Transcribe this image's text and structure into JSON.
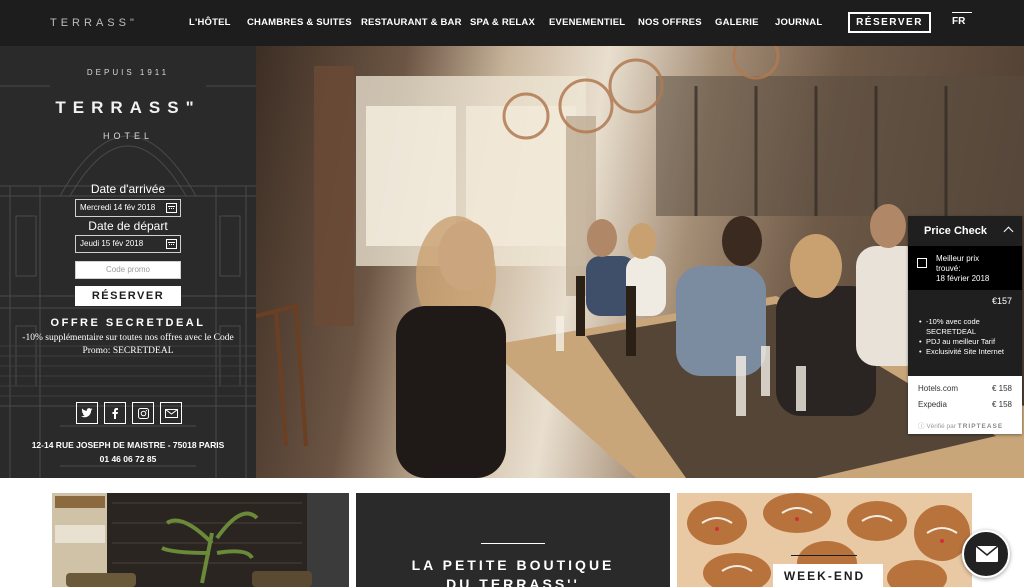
{
  "header": {
    "logo_text": "TERRASS\"",
    "nav": [
      {
        "label": "L'HÔTEL"
      },
      {
        "label": "CHAMBRES & SUITES"
      },
      {
        "label": "RESTAURANT & BAR"
      },
      {
        "label": "SPA & RELAX"
      },
      {
        "label": "EVENEMENTIEL"
      },
      {
        "label": "NOS OFFRES"
      },
      {
        "label": "GALERIE"
      },
      {
        "label": "JOURNAL"
      }
    ],
    "reserve_label": "RÉSERVER",
    "lang": "FR"
  },
  "booking": {
    "depuis": "DEPUIS 1911",
    "brand": "TERRASS\"",
    "hotel": "HOTEL",
    "arrival_label": "Date d'arrivée",
    "arrival_value": "Mercredi 14 fév 2018",
    "departure_label": "Date de départ",
    "departure_value": "Jeudi 15 fév 2018",
    "promo_placeholder": "Code promo",
    "reserve_label": "RÉSERVER",
    "offer_title": "OFFRE SECRETDEAL",
    "offer_line1": "-10% supplémentaire sur toutes nos offres avec le Code",
    "offer_line2": "Promo: SECRETDEAL",
    "social_icons": [
      "twitter-icon",
      "facebook-icon",
      "instagram-icon",
      "mail-icon"
    ],
    "address": "12-14 RUE JOSEPH DE MAISTRE - 75018 PARIS",
    "phone": "01 46 06 72 85"
  },
  "price_check": {
    "title": "Price Check",
    "best_line1": "Meilleur prix",
    "best_line2": "trouvé:",
    "best_line3": "18 février 2018",
    "price": "€157",
    "perks": [
      "-10% avec code SECRETDEAL",
      "PDJ au meilleur Tarif",
      "Exclusivité Site Internet"
    ],
    "others": [
      {
        "site": "Hotels.com",
        "price": "€ 158"
      },
      {
        "site": "Expedia",
        "price": "€ 158"
      }
    ],
    "verified_prefix": "Vérifié par",
    "verified_brand": "TRIPTEASE"
  },
  "cards": {
    "boutique_line1": "LA PETITE BOUTIQUE",
    "boutique_line2": "DU TERRASS''",
    "weekend": "WEEK-END"
  },
  "colors": {
    "dark": "#1d1d1d",
    "panel": "#2a2a2a",
    "white": "#ffffff"
  }
}
